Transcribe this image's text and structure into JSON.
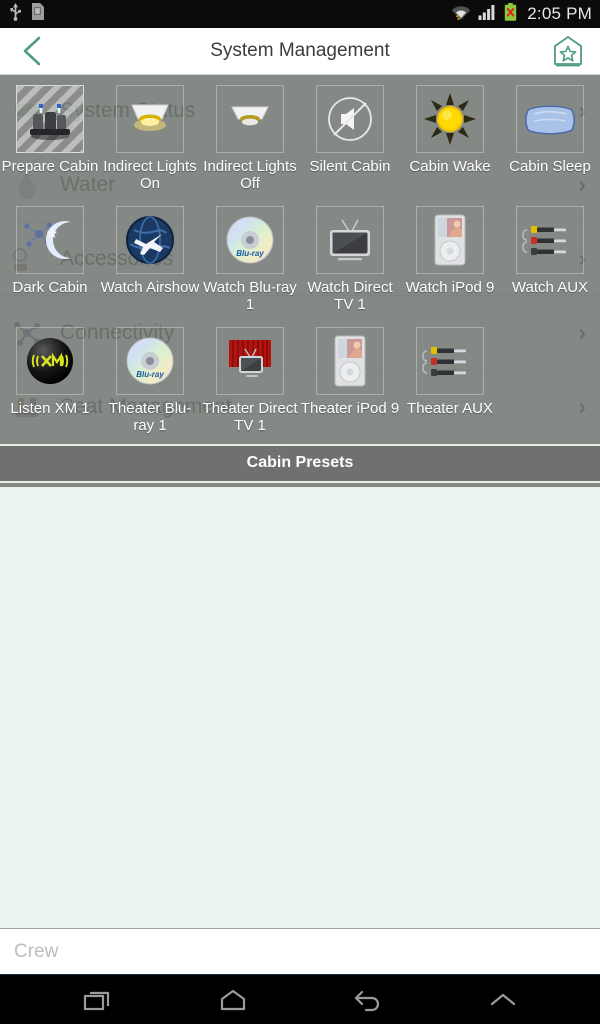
{
  "status_bar": {
    "left_icons": [
      "usb-icon",
      "sd-card-icon"
    ],
    "right_icons": [
      "wifi-icon",
      "signal-icon",
      "battery-error-icon"
    ],
    "clock": "2:05 PM"
  },
  "header": {
    "title": "System Management",
    "back_icon": "back-chevron-icon",
    "favorite_icon": "home-star-icon",
    "accent_color": "#4f9d7e"
  },
  "background_list": {
    "items": [
      {
        "label": "System Status",
        "icon": "status-icon",
        "chevron": "›"
      },
      {
        "label": "Water",
        "icon": "water-icon",
        "chevron": "›"
      },
      {
        "label": "Accessories",
        "icon": "accessories-icon",
        "chevron": "›"
      },
      {
        "label": "Connectivity",
        "icon": "connectivity-icon",
        "chevron": "›"
      },
      {
        "label": "Seat Management",
        "icon": "seat-icon",
        "chevron": "›"
      }
    ]
  },
  "presets_panel": {
    "section_title": "Cabin Presets",
    "tiles": [
      {
        "label": "Prepare Cabin",
        "icon": "cabin-seats-icon",
        "selected": true
      },
      {
        "label": "Indirect Lights On",
        "icon": "downlight-on-icon",
        "selected": false
      },
      {
        "label": "Indirect Lights Off",
        "icon": "downlight-off-icon",
        "selected": false
      },
      {
        "label": "Silent Cabin",
        "icon": "mute-speaker-icon",
        "selected": false
      },
      {
        "label": "Cabin Wake",
        "icon": "sun-icon",
        "selected": false
      },
      {
        "label": "Cabin Sleep",
        "icon": "pillow-icon",
        "selected": false
      },
      {
        "label": "Dark Cabin",
        "icon": "moon-stars-icon",
        "selected": false
      },
      {
        "label": "Watch Airshow",
        "icon": "airshow-globe-icon",
        "selected": false
      },
      {
        "label": "Watch Blu-ray 1",
        "icon": "bluray-disc-icon",
        "selected": false
      },
      {
        "label": "Watch Direct TV 1",
        "icon": "television-icon",
        "selected": false
      },
      {
        "label": "Watch iPod 9",
        "icon": "ipod-icon",
        "selected": false
      },
      {
        "label": "Watch AUX",
        "icon": "aux-cables-icon",
        "selected": false
      },
      {
        "label": "Listen XM 1",
        "icon": "xm-radio-icon",
        "selected": false
      },
      {
        "label": "Theater Blu-ray 1",
        "icon": "bluray-disc-icon",
        "selected": false
      },
      {
        "label": "Theater Direct TV 1",
        "icon": "theater-curtain-icon",
        "selected": false
      },
      {
        "label": "Theater iPod 9",
        "icon": "ipod-icon",
        "selected": false
      },
      {
        "label": "Theater AUX",
        "icon": "aux-cables-icon",
        "selected": false
      }
    ]
  },
  "footer": {
    "field_text": "Crew"
  },
  "nav_bar": {
    "buttons": [
      {
        "name": "recents-icon"
      },
      {
        "name": "home-icon"
      },
      {
        "name": "back-icon"
      },
      {
        "name": "up-chevron-icon"
      }
    ]
  }
}
